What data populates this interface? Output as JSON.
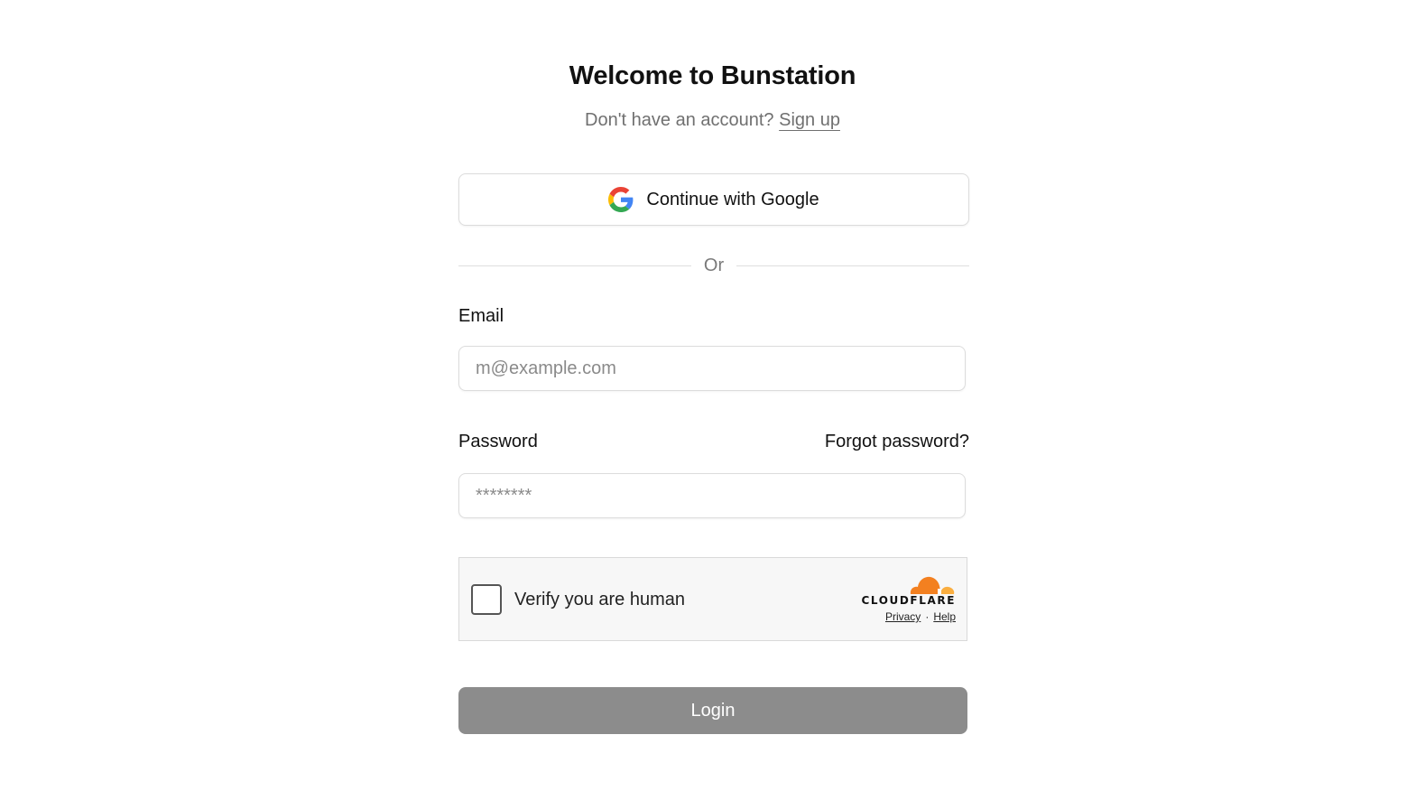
{
  "header": {
    "title": "Welcome to Bunstation",
    "subtitle_prefix": "Don't have an account?",
    "signup_link": "Sign up"
  },
  "google_button": {
    "label": "Continue with Google",
    "icon": "google-g-icon"
  },
  "divider": {
    "text": "Or"
  },
  "email": {
    "label": "Email",
    "value": "",
    "placeholder": "m@example.com"
  },
  "password": {
    "label": "Password",
    "forgot_link": "Forgot password?",
    "value": "",
    "placeholder": "********"
  },
  "captcha": {
    "label": "Verify you are human",
    "checked": false,
    "brand": "CLOUDFLARE",
    "privacy_link": "Privacy",
    "separator": "·",
    "help_link": "Help"
  },
  "login_button": {
    "label": "Login"
  },
  "colors": {
    "login_button_bg": "#8c8c8c",
    "cloudflare_orange": "#f38020",
    "cloudflare_light_orange": "#faae40",
    "muted_text": "#707070"
  }
}
